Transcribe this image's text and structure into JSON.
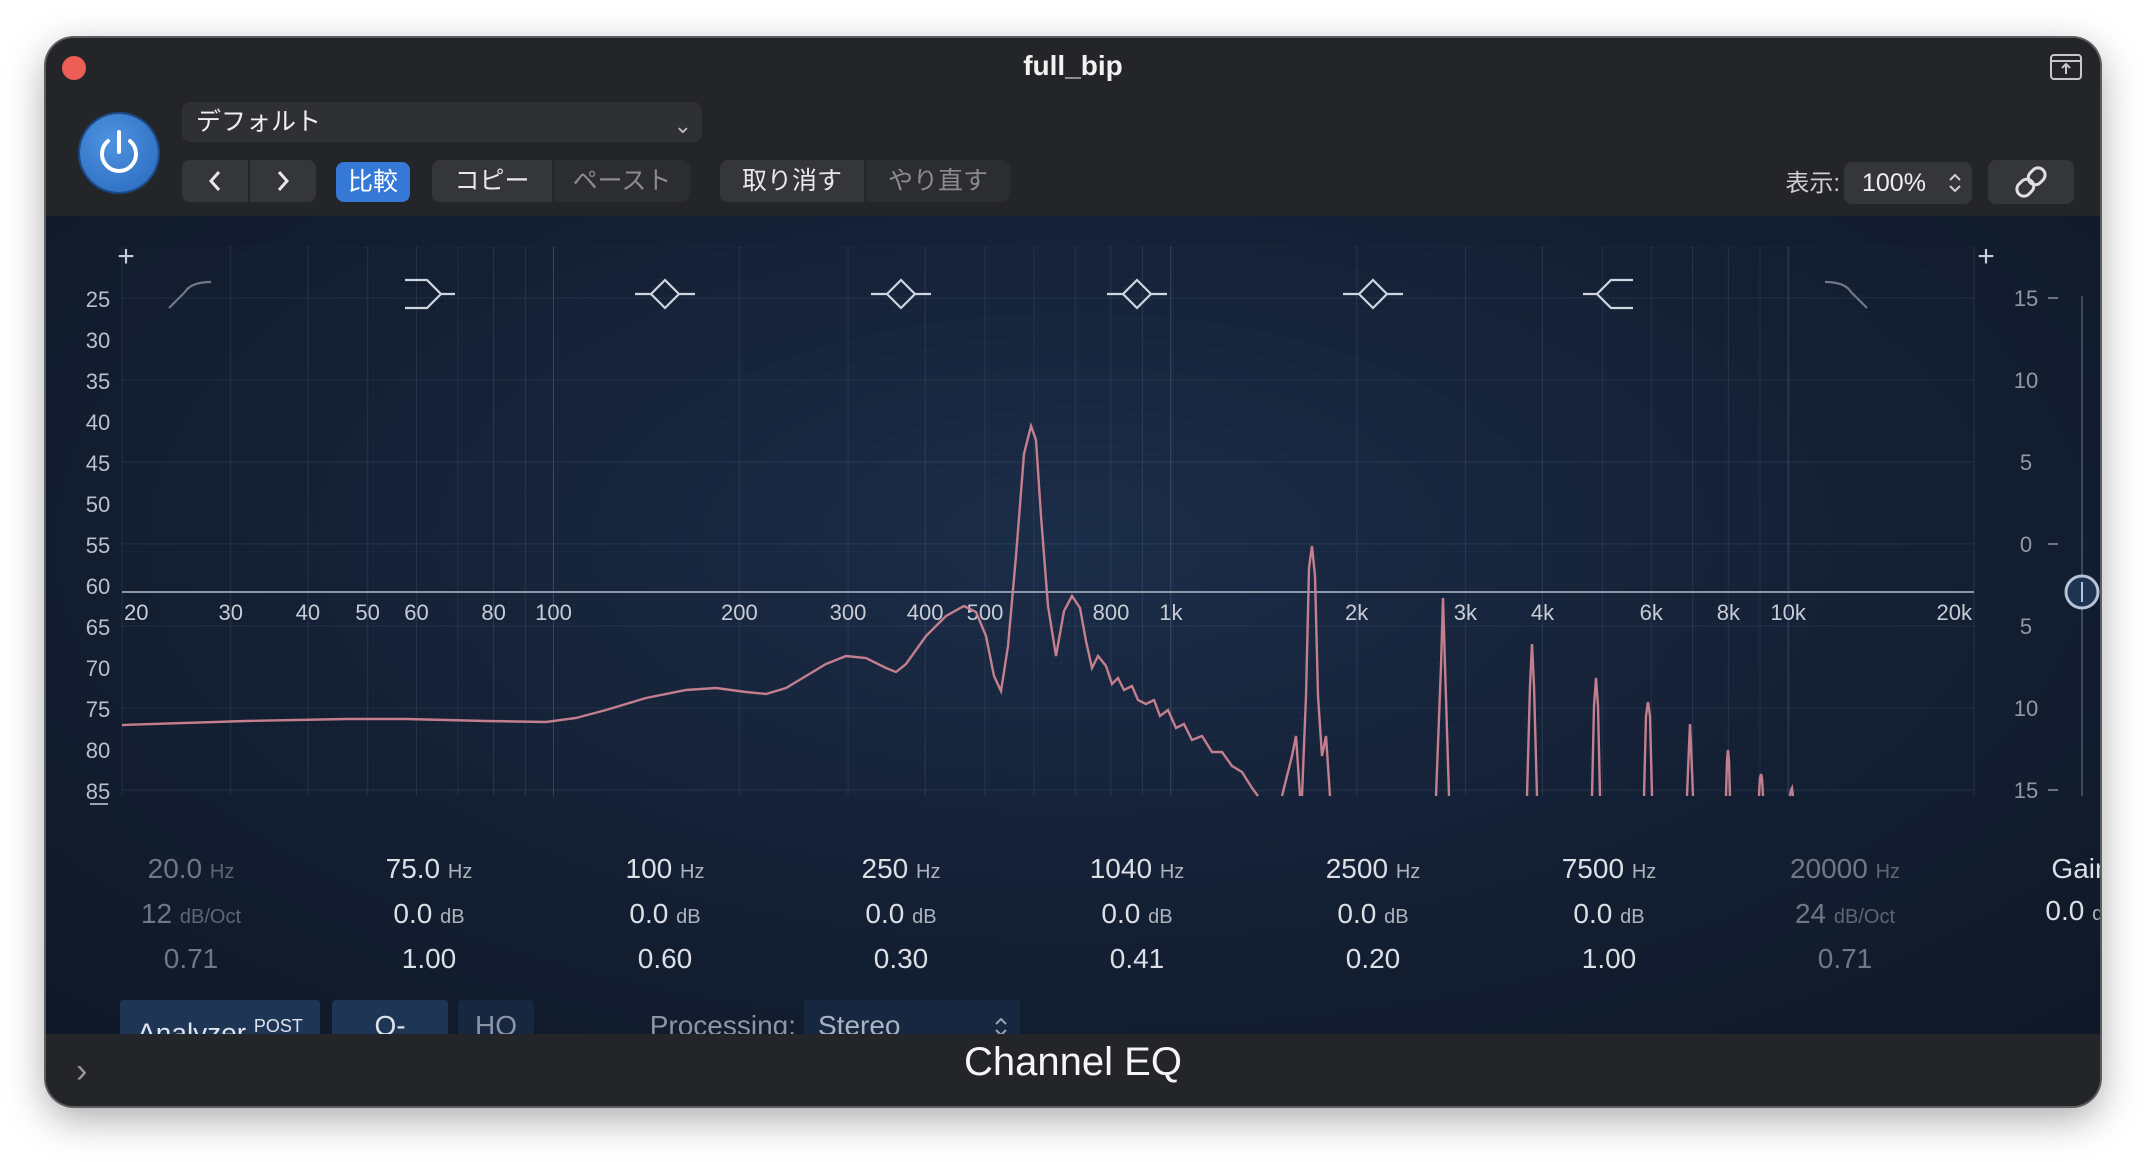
{
  "window": {
    "title": "full_bip"
  },
  "header": {
    "preset": "デフォルト",
    "compare": "比較",
    "copy": "コピー",
    "paste": "ペースト",
    "undo": "取り消す",
    "redo": "やり直す",
    "view_label": "表示:",
    "zoom": "100%"
  },
  "graph": {
    "left_scale": [
      "25",
      "30",
      "35",
      "40",
      "45",
      "50",
      "55",
      "60",
      "65",
      "70",
      "75",
      "80",
      "85"
    ],
    "right_scale": [
      "15",
      "10",
      "5",
      "0",
      "5",
      "10",
      "15"
    ],
    "freq_labels": [
      "20",
      "30",
      "40",
      "50",
      "60",
      "80",
      "100",
      "200",
      "300",
      "400",
      "500",
      "800",
      "1k",
      "2k",
      "3k",
      "4k",
      "6k",
      "8k",
      "10k",
      "20k"
    ],
    "plus": "+"
  },
  "bands": [
    {
      "freq": "20.0",
      "freq_unit": "Hz",
      "gain": "12",
      "gain_unit": "dB/Oct",
      "q": "0.71",
      "active": false,
      "shape": "high-pass-icon"
    },
    {
      "freq": "75.0",
      "freq_unit": "Hz",
      "gain": "0.0",
      "gain_unit": "dB",
      "q": "1.00",
      "active": true,
      "shape": "low-shelf-icon"
    },
    {
      "freq": "100",
      "freq_unit": "Hz",
      "gain": "0.0",
      "gain_unit": "dB",
      "q": "0.60",
      "active": true,
      "shape": "bell-icon"
    },
    {
      "freq": "250",
      "freq_unit": "Hz",
      "gain": "0.0",
      "gain_unit": "dB",
      "q": "0.30",
      "active": true,
      "shape": "bell-icon"
    },
    {
      "freq": "1040",
      "freq_unit": "Hz",
      "gain": "0.0",
      "gain_unit": "dB",
      "q": "0.41",
      "active": true,
      "shape": "bell-icon"
    },
    {
      "freq": "2500",
      "freq_unit": "Hz",
      "gain": "0.0",
      "gain_unit": "dB",
      "q": "0.20",
      "active": true,
      "shape": "bell-icon"
    },
    {
      "freq": "7500",
      "freq_unit": "Hz",
      "gain": "0.0",
      "gain_unit": "dB",
      "q": "1.00",
      "active": true,
      "shape": "high-shelf-icon"
    },
    {
      "freq": "20000",
      "freq_unit": "Hz",
      "gain": "24",
      "gain_unit": "dB/Oct",
      "q": "0.71",
      "active": false,
      "shape": "low-pass-icon"
    }
  ],
  "gain": {
    "label": "Gain",
    "value": "0.0",
    "unit": "dB"
  },
  "footer": {
    "analyzer": "Analyzer",
    "analyzer_sup": "POST",
    "q_couple": "Q-Couple",
    "hq": "HQ",
    "processing_label": "Processing:",
    "processing_value": "Stereo"
  },
  "plugin_name": "Channel EQ",
  "colors": {
    "accent": "#3578d6",
    "analyzer": "#c47f8e",
    "close": "#ed5e56"
  }
}
